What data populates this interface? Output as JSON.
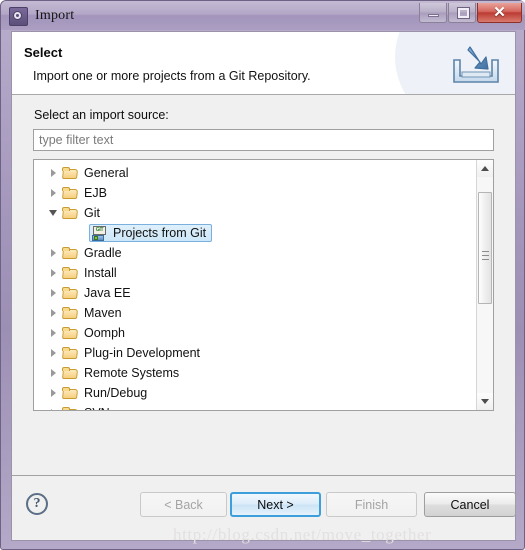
{
  "window": {
    "title": "Import",
    "app_icon": "eclipse-gear-icon",
    "controls": {
      "minimize": "minimize-icon",
      "maximize": "maximize-icon",
      "close": "✕"
    },
    "titlebar_color": "#a294bb",
    "frame_color": "#9c8fb4"
  },
  "header": {
    "title": "Select",
    "description": "Import one or more projects from a Git Repository.",
    "icon": "import-arrow-into-tray-icon"
  },
  "body": {
    "source_label": "Select an import source:",
    "filter": {
      "value": "",
      "placeholder": "type filter text"
    },
    "tree": {
      "selected": "Projects from Git",
      "selection_bg": "#cde7f8",
      "selection_border": "#7ab0dd",
      "items": [
        {
          "label": "General",
          "type": "folder",
          "state": "collapsed",
          "depth": 0
        },
        {
          "label": "EJB",
          "type": "folder",
          "state": "collapsed",
          "depth": 0
        },
        {
          "label": "Git",
          "type": "folder",
          "state": "expanded",
          "depth": 0
        },
        {
          "label": "Projects from Git",
          "type": "git",
          "state": "leaf",
          "depth": 1,
          "selected": true
        },
        {
          "label": "Gradle",
          "type": "folder",
          "state": "collapsed",
          "depth": 0
        },
        {
          "label": "Install",
          "type": "folder",
          "state": "collapsed",
          "depth": 0
        },
        {
          "label": "Java EE",
          "type": "folder",
          "state": "collapsed",
          "depth": 0
        },
        {
          "label": "Maven",
          "type": "folder",
          "state": "collapsed",
          "depth": 0
        },
        {
          "label": "Oomph",
          "type": "folder",
          "state": "collapsed",
          "depth": 0
        },
        {
          "label": "Plug-in Development",
          "type": "folder",
          "state": "collapsed",
          "depth": 0
        },
        {
          "label": "Remote Systems",
          "type": "folder",
          "state": "collapsed",
          "depth": 0
        },
        {
          "label": "Run/Debug",
          "type": "folder",
          "state": "collapsed",
          "depth": 0
        },
        {
          "label": "SVN",
          "type": "folder",
          "state": "collapsed",
          "depth": 0
        }
      ],
      "git_icon_text": "GIT"
    },
    "scrollbar": {
      "up_arrow": "scroll-up-icon",
      "down_arrow": "scroll-down-icon",
      "thumb_top_pct": 7,
      "thumb_height_pct": 52
    }
  },
  "footer": {
    "help": "?",
    "buttons": [
      {
        "label": "< Back",
        "state": "disabled"
      },
      {
        "label": "Next >",
        "state": "default"
      },
      {
        "label": "Finish",
        "state": "disabled"
      },
      {
        "label": "Cancel",
        "state": "enabled"
      }
    ]
  },
  "watermark": "http://blog.csdn.net/move_together"
}
